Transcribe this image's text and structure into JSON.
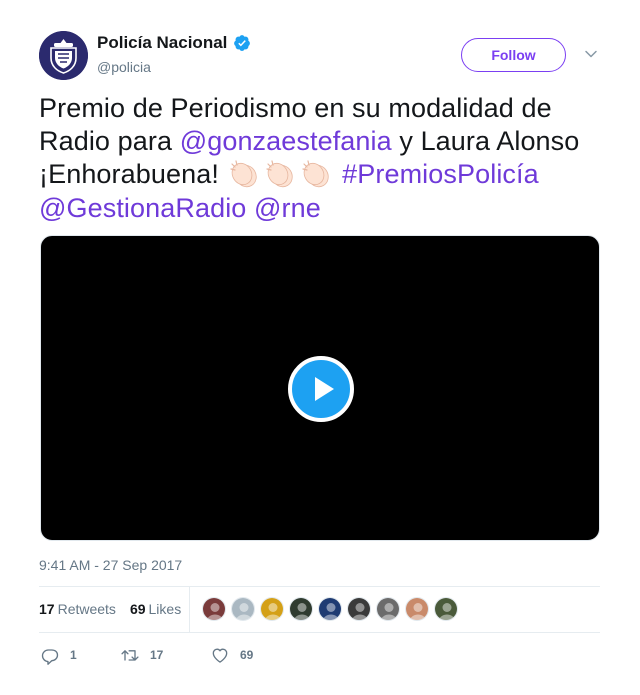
{
  "author": {
    "name": "Policía Nacional",
    "handle": "@policia",
    "verified": true,
    "avatar_icon": "policia-emblem"
  },
  "follow_label": "Follow",
  "tweet": {
    "line1": "Premio de Periodismo en su modalidad de",
    "line2_pre": "Radio para ",
    "mention1": "@gonzaestefania",
    "line2_post": " y Laura Alonso",
    "line3_pre": "¡Enhorabuena! ",
    "hashtag": "#PremiosPolicía",
    "mention2": "@GestionaRadio",
    "mention3": "@rne",
    "emoji_icon": "clapping-hands-icon",
    "emoji_count": 3
  },
  "video": {
    "play_icon": "play-icon"
  },
  "timestamp": "9:41 AM - 27 Sep 2017",
  "stats": {
    "retweets_count": "17",
    "retweets_label": "Retweets",
    "likes_count": "69",
    "likes_label": "Likes"
  },
  "likers": [
    {
      "color": "#7a3b3b"
    },
    {
      "color": "#aab8c2"
    },
    {
      "color": "#d4a017"
    },
    {
      "color": "#2f3b2f"
    },
    {
      "color": "#1f3b73"
    },
    {
      "color": "#3a3a3a"
    },
    {
      "color": "#6b6b6b"
    },
    {
      "color": "#c98a6a"
    },
    {
      "color": "#4a5a3a"
    }
  ],
  "actions": {
    "reply_count": "1",
    "retweet_count": "17",
    "like_count": "69"
  },
  "colors": {
    "link": "#6f3ad9",
    "play_button": "#1da1f2",
    "follow_border": "#7b3ff2",
    "meta_text": "#657786"
  }
}
